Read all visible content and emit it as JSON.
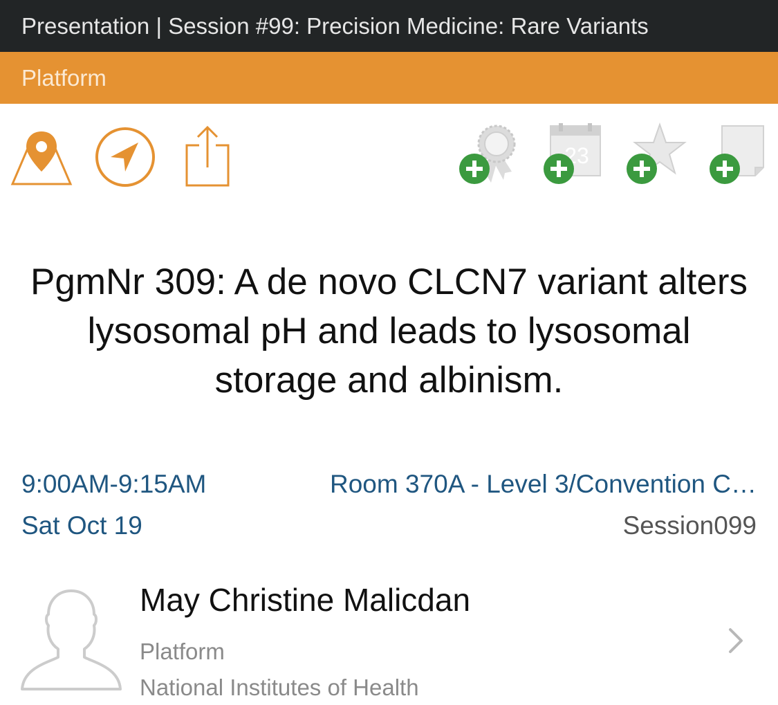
{
  "header": {
    "title": "Presentation | Session #99: Precision Medicine: Rare Variants",
    "category": "Platform"
  },
  "toolbar": {
    "left_icons": [
      "map-location-icon",
      "navigation-icon",
      "share-icon"
    ],
    "right_icons": [
      "add-award-icon",
      "add-calendar-icon",
      "add-favorite-icon",
      "add-note-icon"
    ],
    "calendar_day": "23",
    "accent_color": "#e59232",
    "add_badge_color": "#3b9a3f"
  },
  "presentation": {
    "title": "PgmNr 309: A de novo CLCN7 variant alters lysosomal pH and leads to lysosomal storage and albinism."
  },
  "details": {
    "time": "9:00AM-9:15AM",
    "date": "Sat Oct 19",
    "location": "Room 370A - Level 3/Convention C…",
    "session_code": "Session099"
  },
  "presenter": {
    "name": "May Christine Malicdan",
    "role": "Platform",
    "organization": "National Institutes of Health"
  }
}
